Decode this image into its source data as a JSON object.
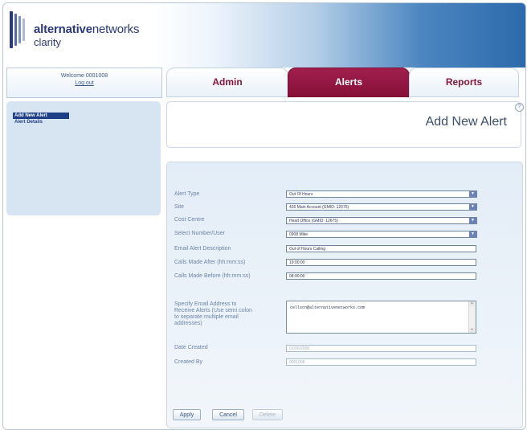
{
  "brand": {
    "name_bold": "alternative",
    "name_light": "networks",
    "product": "clarity"
  },
  "session": {
    "welcome": "Welcome 0001008",
    "logout": "Log out"
  },
  "tabs": [
    {
      "label": "Admin",
      "active": false
    },
    {
      "label": "Alerts",
      "active": true
    },
    {
      "label": "Reports",
      "active": false
    }
  ],
  "sidebar": {
    "items": [
      {
        "label": "Add New Alert",
        "active": true
      },
      {
        "label": "Alert Details",
        "active": false
      }
    ]
  },
  "page": {
    "title": "Add New Alert"
  },
  "form": {
    "alert_type": {
      "label": "Alert Type",
      "value": "Out Of Hours"
    },
    "site": {
      "label": "Site",
      "value": "426 Main Account (GMID: 12675)"
    },
    "cost_centre": {
      "label": "Cost Centre",
      "value": "Head Office (GMID: 12675)"
    },
    "select_number_user": {
      "label": "Select Number/User",
      "value": "0908 Mike"
    },
    "email_alert_description": {
      "label": "Email Alert Description",
      "value": "Out of Hours Calling"
    },
    "calls_made_after": {
      "label": "Calls Made After (hh:mm:ss)",
      "value": "19:00:00"
    },
    "calls_made_before": {
      "label": "Calls Made Before (hh:mm:ss)",
      "value": "08:00:00"
    },
    "email_addresses": {
      "label": "Specify Email Address to\nReceive Alerts (Use semi colon\nto separate multiple email\naddresses)",
      "value": "cellscn@alternativenetworks.com"
    },
    "date_created": {
      "label": "Date Created",
      "value": "01/06/2008"
    },
    "created_by": {
      "label": "Created By",
      "value": "0001008"
    }
  },
  "buttons": {
    "apply": "Apply",
    "cancel": "Cancel",
    "delete": "Delete"
  },
  "colors": {
    "accent": "#8a1838",
    "active_tab": "#9b1b48",
    "nav_blue": "#1d3f86",
    "header_blue": "#2c6aab"
  },
  "icons": {
    "select_arrow": "chevron-down-icon",
    "corner": "help-icon"
  }
}
